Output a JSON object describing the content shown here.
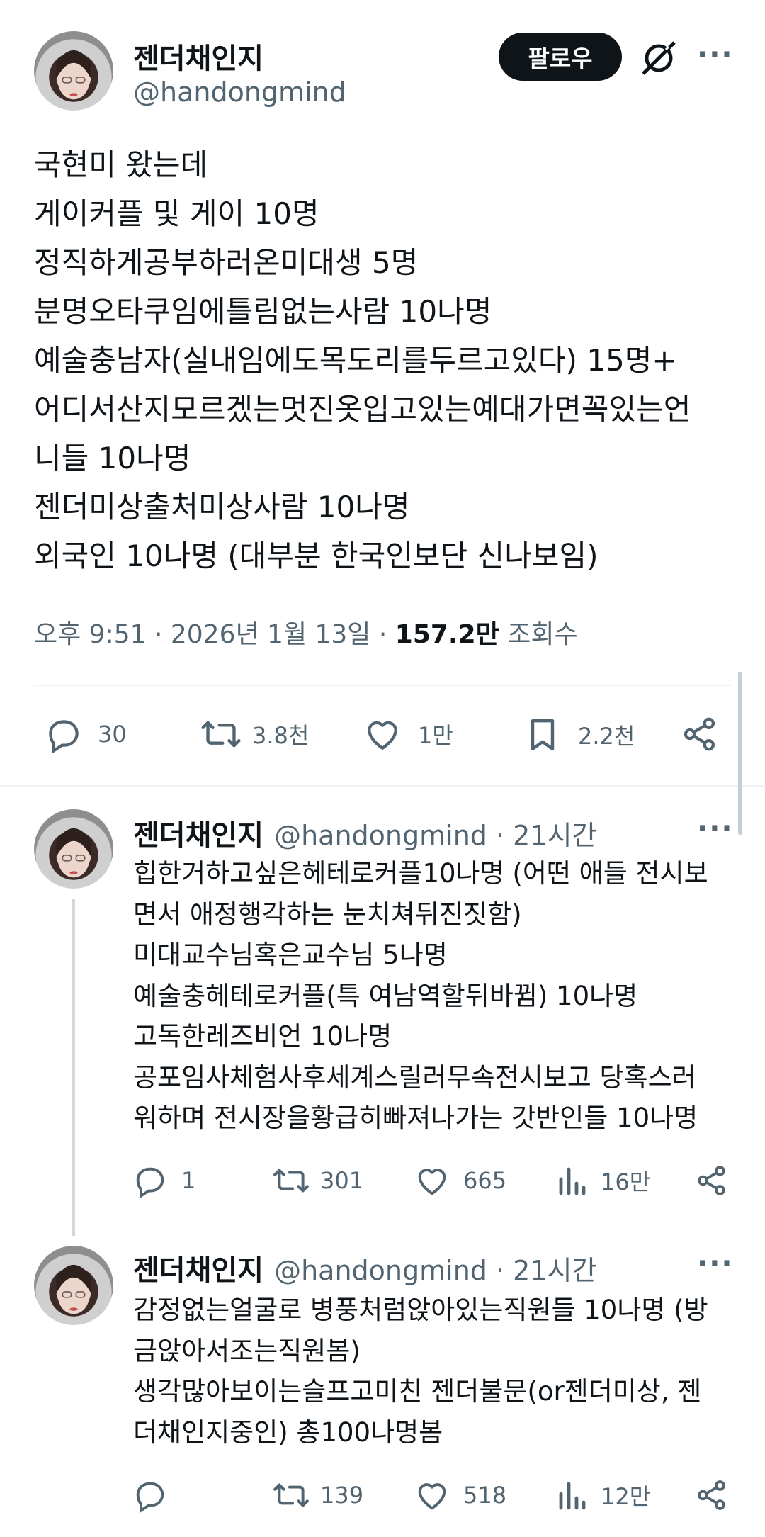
{
  "main_tweet": {
    "author_name": "젠더채인지",
    "author_handle": "@handongmind",
    "follow_label": "팔로우",
    "text": "국현미 왔는데\n게이커플 및 게이 10명\n정직하게공부하러온미대생 5명\n분명오타쿠임에틀림없는사람 10나명\n예술충남자(실내임에도목도리를두르고있다) 15명+\n어디서산지모르겠는멋진옷입고있는예대가면꼭있는언\n니들 10나명\n젠더미상출처미상사람 10나명\n외국인 10나명 (대부분 한국인보단 신나보임)",
    "time": "오후 9:51 · 2026년 1월 13일 · ",
    "views_count": "157.2만",
    "views_label": " 조회수",
    "replies": "30",
    "retweets": "3.8천",
    "likes": "1만",
    "bookmarks": "2.2천"
  },
  "replies": [
    {
      "author_name": "젠더채인지",
      "author_handle": "@handongmind",
      "time_ago": "21시간",
      "text": "힙한거하고싶은헤테로커플10나명 (어떤 애들 전시보\n면서 애정행각하는 눈치쳐뒤진짓함)\n미대교수님혹은교수님 5나명\n예술충헤테로커플(특 여남역할뒤바뀜) 10나명\n고독한레즈비언 10나명\n공포임사체험사후세계스릴러무속전시보고 당혹스러\n워하며 전시장을황급히빠져나가는 갓반인들 10나명",
      "replies": "1",
      "retweets": "301",
      "likes": "665",
      "views": "16만"
    },
    {
      "author_name": "젠더채인지",
      "author_handle": "@handongmind",
      "time_ago": "21시간",
      "text": "감정없는얼굴로 병풍처럼앉아있는직원들 10나명 (방\n금앉아서조는직원봄)\n생각많아보이는슬프고미친 젠더불문(or젠더미상, 젠\n더채인지중인) 총100나명봄",
      "replies": "",
      "retweets": "139",
      "likes": "518",
      "views": "12만"
    }
  ],
  "separator": " · ",
  "more_label": "···",
  "icons": [
    "grok-icon",
    "more-icon",
    "reply-icon",
    "retweet-icon",
    "like-icon",
    "bookmark-icon",
    "share-icon",
    "views-icon"
  ]
}
